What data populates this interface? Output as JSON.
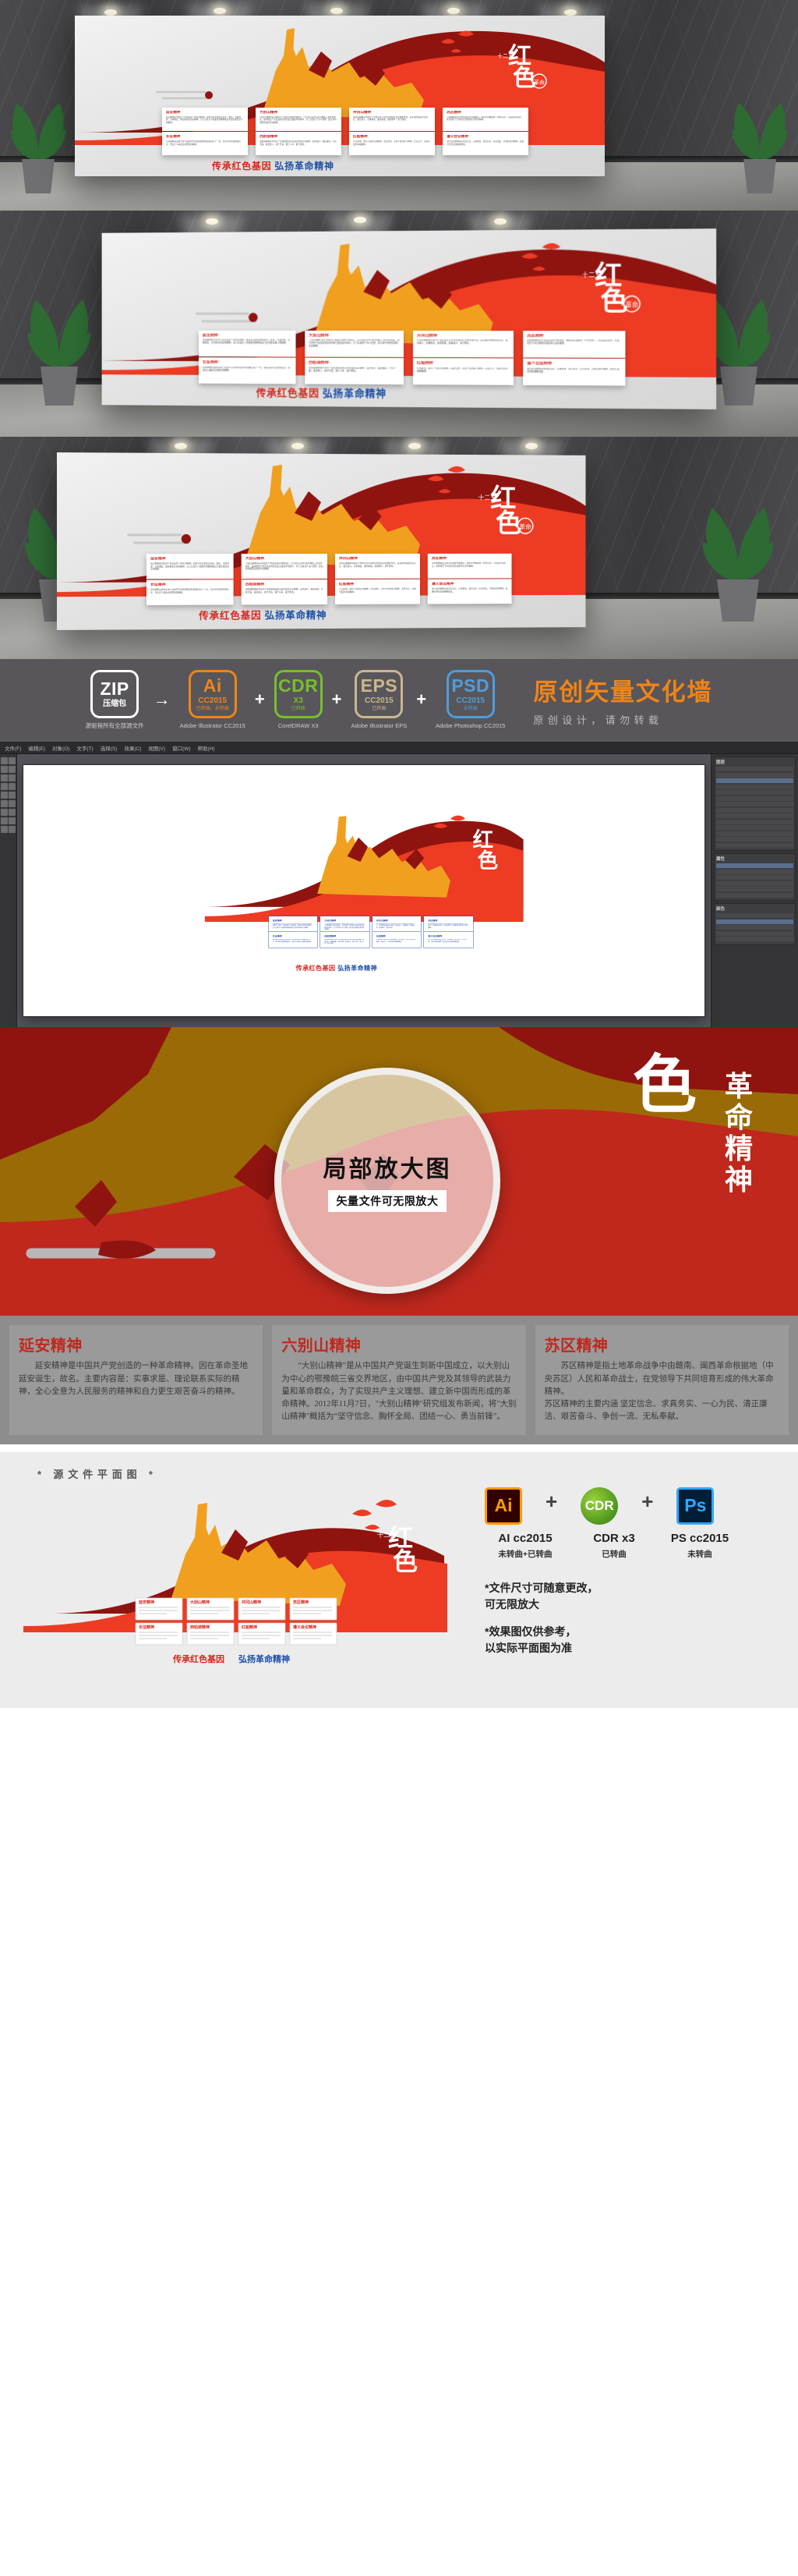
{
  "artwork": {
    "badge_main": "红",
    "badge_sub": "色",
    "badge_small": "十二五",
    "badge_tag": "革命精神",
    "slogan_red": "传承红色基因",
    "slogan_blue": "弘扬革命精神",
    "colors": {
      "red_bright": "#ee3b24",
      "red_dark": "#8f1410",
      "gold": "#f0a01e",
      "accent_blue": "#1d4fa8",
      "accent_red": "#d6261d"
    }
  },
  "info_cards": [
    {
      "title": "延安精神",
      "body": "延安精神是中国共产党创造的一种革命精神。因在革命圣地延安诞生，故名。主要内容：实事求是、理论联系实际的精神，全心全意为人民服务的精神和自力更生艰苦奋斗的精神。"
    },
    {
      "title": "大别山精神",
      "body": "“大别山精神”是从中国共产党诞生到新中国成立，以大别山为中心的鄂豫皖三省交界地区，由中国共产党及其领导的武装力量和革命群众，为了实现共产主义理想、建立新中国而形成的革命精神。"
    },
    {
      "title": "井冈山精神",
      "body": "井冈山精神是中国共产党在革命斗争中形成的优良传统和作风，其主要内涵是坚定信念、艰苦奋斗，实事求是、敢闯新路，依靠群众、勇于胜利。"
    },
    {
      "title": "苏区精神",
      "body": "苏区精神是指土地革命战争中由赣南、闽西革命根据地（中央苏区）人民和革命战士，在党领导下共同培育形成的伟大革命精神。"
    },
    {
      "title": "长征精神",
      "body": "长征精神就是把全国人民和中华民族的根本利益看得高于一切，坚定革命的理想和信念，坚信正义事业必然胜利的精神。"
    },
    {
      "title": "西柏坡精神",
      "body": "西柏坡精神是中国共产党在解放战争后期形成的革命精神，其内涵为：谦虚谨慎、不骄不躁，艰苦奋斗、勇于开拓，敢于斗争、敢于胜利。"
    },
    {
      "title": "红船精神",
      "body": "开天辟地、敢为人先的首创精神，坚定理想、百折不挠的奋斗精神，立党为公、忠诚为民的奉献精神。"
    },
    {
      "title": "遵义会议精神",
      "body": "遵义会议精神就是坚定信念、实事求是、独立自主、民主团结、务求必胜的精神，是我们党宝贵的精神财富。"
    }
  ],
  "format_bar": {
    "badges": [
      {
        "abbr": "ZIP",
        "version": "压缩包",
        "sub": "",
        "name": "源驱程所有全部源文件"
      },
      {
        "abbr": "Ai",
        "version": "CC2015",
        "sub": "已转曲、未转曲",
        "name": "Adobe Illustrator\nCC2015"
      },
      {
        "abbr": "CDR",
        "version": "X3",
        "sub": "已转曲",
        "name": "CorelDRAW\nX3"
      },
      {
        "abbr": "EPS",
        "version": "CC2015",
        "sub": "已转曲",
        "name": "Adobe Illustrator\nEPS"
      },
      {
        "abbr": "PSD",
        "version": "CC2015",
        "sub": "未转曲",
        "name": "Adobe Photoshop\nCC2015"
      }
    ],
    "connectors": [
      "→",
      "+",
      "+",
      "+"
    ],
    "title": "原创矢量文化墙",
    "subtitle": "原创设计，请勿转载"
  },
  "software_window": {
    "menus": [
      "文件(F)",
      "编辑(E)",
      "对象(O)",
      "文字(T)",
      "选择(S)",
      "效果(C)",
      "视图(V)",
      "窗口(W)",
      "帮助(H)"
    ],
    "palettes": [
      {
        "name": "图层",
        "rows": 14,
        "selected": 2
      },
      {
        "name": "属性",
        "rows": 6,
        "selected": 0
      },
      {
        "name": "颜色",
        "rows": 5,
        "selected": 1
      }
    ]
  },
  "lens": {
    "title": "局部放大图",
    "subtitle": "矢量文件可无限放大"
  },
  "big_panels": [
    {
      "title": "延安精神",
      "paragraphs": [
        "延安精神是中国共产党创造的一种革命精神。因在革命圣地延安诞生，故名。主要内容是：实事求是、理论联系实际的精神，全心全意为人民服务的精神和自力更生艰苦奋斗的精神。"
      ]
    },
    {
      "title": "六别山精神",
      "paragraphs": [
        "“大别山精神”是从中国共产党诞生到新中国成立，以大别山为中心的鄂豫皖三省交界地区，由中国共产党及其领导的武装力量和革命群众，为了实现共产主义理想、建立新中国而形成的革命精神。2012年11月7日，\"大别山精神\"研究组发布新闻，将\"大别山精神\"概括为“坚守信念、胸怀全局、团结一心、勇当前锋”。"
      ]
    },
    {
      "title": "苏区精神",
      "paragraphs": [
        "苏区精神是指土地革命战争中由赣南、闽西革命根据地（中央苏区）人民和革命战士，在党领导下共同培育形成的伟大革命精神。",
        "苏区精神的主要内涵 坚定信念、求真务实、一心为民、清正廉洁、艰苦奋斗、争创一流、无私奉献。"
      ]
    }
  ],
  "footer": {
    "source_title": "* 源文件平面图 *",
    "apps": [
      {
        "glyph": "Ai",
        "name": "AI cc2015",
        "sub": "未转曲+已转曲"
      },
      {
        "glyph": "CDR",
        "name": "CDR x3",
        "sub": "已转曲"
      },
      {
        "glyph": "Ps",
        "name": "PS cc2015",
        "sub": "未转曲"
      }
    ],
    "plus": "+",
    "notes": [
      "*文件尺寸可随意更改，\n  可无限放大",
      "*效果图仅供参考，\n  以实际平面图为准"
    ]
  }
}
